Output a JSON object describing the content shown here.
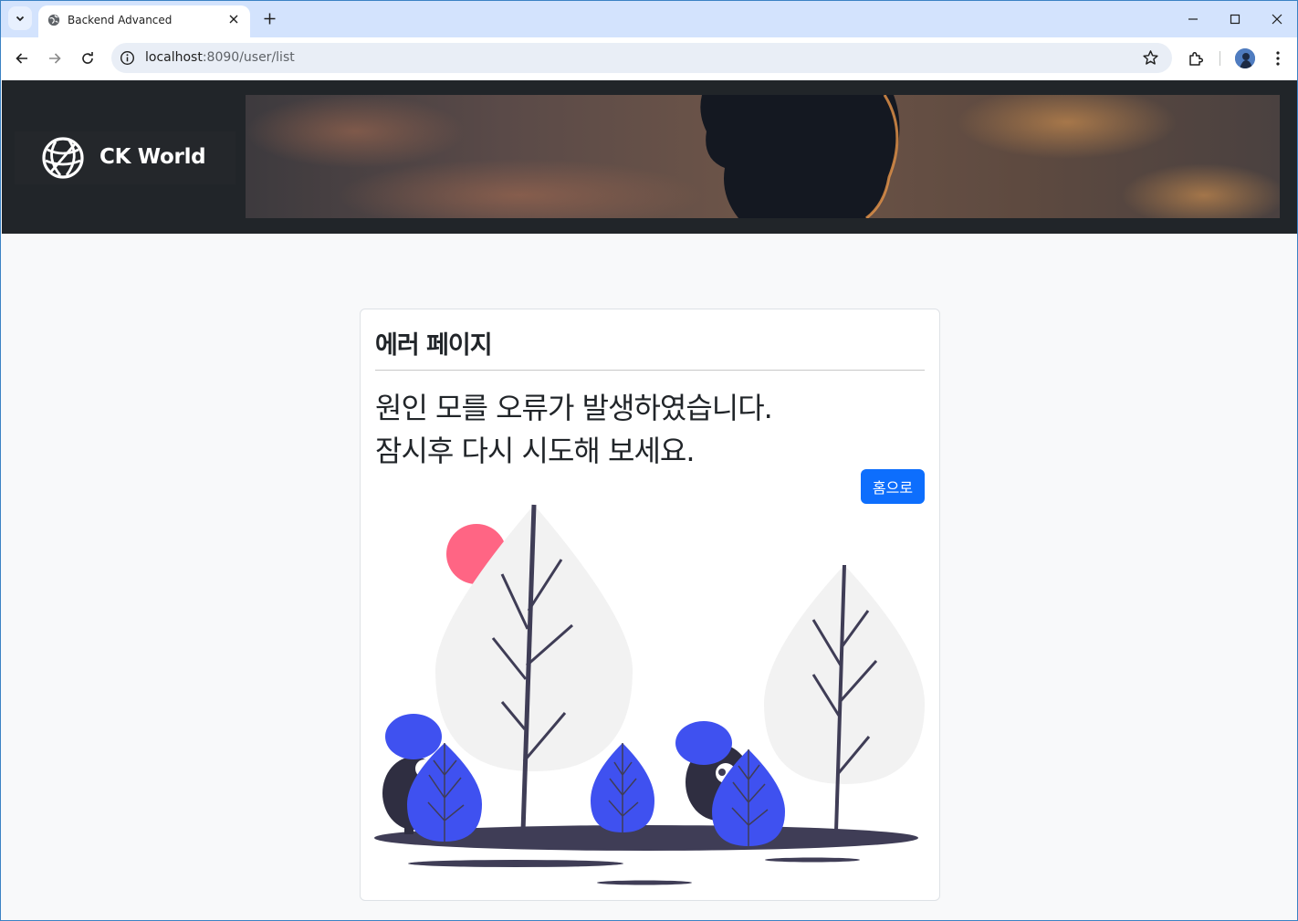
{
  "browser": {
    "tab_title": "Backend Advanced",
    "url_host": "localhost",
    "url_path": ":8090/user/list"
  },
  "header": {
    "brand_name": "CK World"
  },
  "error": {
    "title": "에러 페이지",
    "message_line1": "원인 모를 오류가 발생하였습니다.",
    "message_line2": "잠시후 다시 시도해 보세요.",
    "home_button": "홈으로"
  },
  "colors": {
    "header_bg": "#212529",
    "button_primary": "#0d6efd",
    "illustration_blue": "#3f51f0",
    "illustration_dark": "#3f3d56",
    "illustration_sun": "#ff6584"
  },
  "icons": [
    "tab-menu-icon",
    "globe-icon",
    "close-icon",
    "plus-icon",
    "minimize-icon",
    "maximize-icon",
    "back-icon",
    "forward-icon",
    "reload-icon",
    "info-icon",
    "star-icon",
    "extensions-icon",
    "more-icon"
  ]
}
